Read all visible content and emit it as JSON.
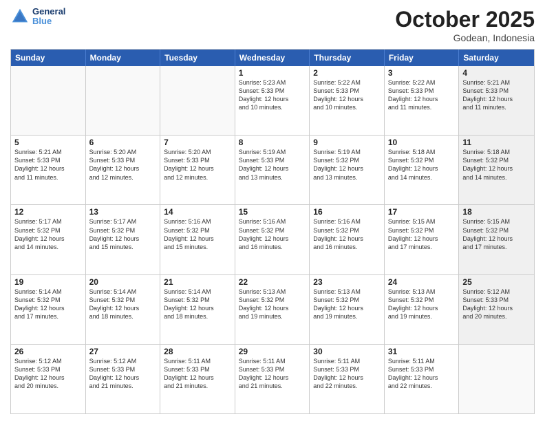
{
  "header": {
    "logo_line1": "General",
    "logo_line2": "Blue",
    "month_title": "October 2025",
    "location": "Godean, Indonesia"
  },
  "day_headers": [
    "Sunday",
    "Monday",
    "Tuesday",
    "Wednesday",
    "Thursday",
    "Friday",
    "Saturday"
  ],
  "weeks": [
    [
      {
        "num": "",
        "info": "",
        "empty": true
      },
      {
        "num": "",
        "info": "",
        "empty": true
      },
      {
        "num": "",
        "info": "",
        "empty": true
      },
      {
        "num": "1",
        "info": "Sunrise: 5:23 AM\nSunset: 5:33 PM\nDaylight: 12 hours\nand 10 minutes.",
        "empty": false
      },
      {
        "num": "2",
        "info": "Sunrise: 5:22 AM\nSunset: 5:33 PM\nDaylight: 12 hours\nand 10 minutes.",
        "empty": false
      },
      {
        "num": "3",
        "info": "Sunrise: 5:22 AM\nSunset: 5:33 PM\nDaylight: 12 hours\nand 11 minutes.",
        "empty": false
      },
      {
        "num": "4",
        "info": "Sunrise: 5:21 AM\nSunset: 5:33 PM\nDaylight: 12 hours\nand 11 minutes.",
        "empty": false,
        "shaded": true
      }
    ],
    [
      {
        "num": "5",
        "info": "Sunrise: 5:21 AM\nSunset: 5:33 PM\nDaylight: 12 hours\nand 11 minutes.",
        "empty": false
      },
      {
        "num": "6",
        "info": "Sunrise: 5:20 AM\nSunset: 5:33 PM\nDaylight: 12 hours\nand 12 minutes.",
        "empty": false
      },
      {
        "num": "7",
        "info": "Sunrise: 5:20 AM\nSunset: 5:33 PM\nDaylight: 12 hours\nand 12 minutes.",
        "empty": false
      },
      {
        "num": "8",
        "info": "Sunrise: 5:19 AM\nSunset: 5:33 PM\nDaylight: 12 hours\nand 13 minutes.",
        "empty": false
      },
      {
        "num": "9",
        "info": "Sunrise: 5:19 AM\nSunset: 5:32 PM\nDaylight: 12 hours\nand 13 minutes.",
        "empty": false
      },
      {
        "num": "10",
        "info": "Sunrise: 5:18 AM\nSunset: 5:32 PM\nDaylight: 12 hours\nand 14 minutes.",
        "empty": false
      },
      {
        "num": "11",
        "info": "Sunrise: 5:18 AM\nSunset: 5:32 PM\nDaylight: 12 hours\nand 14 minutes.",
        "empty": false,
        "shaded": true
      }
    ],
    [
      {
        "num": "12",
        "info": "Sunrise: 5:17 AM\nSunset: 5:32 PM\nDaylight: 12 hours\nand 14 minutes.",
        "empty": false
      },
      {
        "num": "13",
        "info": "Sunrise: 5:17 AM\nSunset: 5:32 PM\nDaylight: 12 hours\nand 15 minutes.",
        "empty": false
      },
      {
        "num": "14",
        "info": "Sunrise: 5:16 AM\nSunset: 5:32 PM\nDaylight: 12 hours\nand 15 minutes.",
        "empty": false
      },
      {
        "num": "15",
        "info": "Sunrise: 5:16 AM\nSunset: 5:32 PM\nDaylight: 12 hours\nand 16 minutes.",
        "empty": false
      },
      {
        "num": "16",
        "info": "Sunrise: 5:16 AM\nSunset: 5:32 PM\nDaylight: 12 hours\nand 16 minutes.",
        "empty": false
      },
      {
        "num": "17",
        "info": "Sunrise: 5:15 AM\nSunset: 5:32 PM\nDaylight: 12 hours\nand 17 minutes.",
        "empty": false
      },
      {
        "num": "18",
        "info": "Sunrise: 5:15 AM\nSunset: 5:32 PM\nDaylight: 12 hours\nand 17 minutes.",
        "empty": false,
        "shaded": true
      }
    ],
    [
      {
        "num": "19",
        "info": "Sunrise: 5:14 AM\nSunset: 5:32 PM\nDaylight: 12 hours\nand 17 minutes.",
        "empty": false
      },
      {
        "num": "20",
        "info": "Sunrise: 5:14 AM\nSunset: 5:32 PM\nDaylight: 12 hours\nand 18 minutes.",
        "empty": false
      },
      {
        "num": "21",
        "info": "Sunrise: 5:14 AM\nSunset: 5:32 PM\nDaylight: 12 hours\nand 18 minutes.",
        "empty": false
      },
      {
        "num": "22",
        "info": "Sunrise: 5:13 AM\nSunset: 5:32 PM\nDaylight: 12 hours\nand 19 minutes.",
        "empty": false
      },
      {
        "num": "23",
        "info": "Sunrise: 5:13 AM\nSunset: 5:32 PM\nDaylight: 12 hours\nand 19 minutes.",
        "empty": false
      },
      {
        "num": "24",
        "info": "Sunrise: 5:13 AM\nSunset: 5:32 PM\nDaylight: 12 hours\nand 19 minutes.",
        "empty": false
      },
      {
        "num": "25",
        "info": "Sunrise: 5:12 AM\nSunset: 5:33 PM\nDaylight: 12 hours\nand 20 minutes.",
        "empty": false,
        "shaded": true
      }
    ],
    [
      {
        "num": "26",
        "info": "Sunrise: 5:12 AM\nSunset: 5:33 PM\nDaylight: 12 hours\nand 20 minutes.",
        "empty": false
      },
      {
        "num": "27",
        "info": "Sunrise: 5:12 AM\nSunset: 5:33 PM\nDaylight: 12 hours\nand 21 minutes.",
        "empty": false
      },
      {
        "num": "28",
        "info": "Sunrise: 5:11 AM\nSunset: 5:33 PM\nDaylight: 12 hours\nand 21 minutes.",
        "empty": false
      },
      {
        "num": "29",
        "info": "Sunrise: 5:11 AM\nSunset: 5:33 PM\nDaylight: 12 hours\nand 21 minutes.",
        "empty": false
      },
      {
        "num": "30",
        "info": "Sunrise: 5:11 AM\nSunset: 5:33 PM\nDaylight: 12 hours\nand 22 minutes.",
        "empty": false
      },
      {
        "num": "31",
        "info": "Sunrise: 5:11 AM\nSunset: 5:33 PM\nDaylight: 12 hours\nand 22 minutes.",
        "empty": false
      },
      {
        "num": "",
        "info": "",
        "empty": true,
        "shaded": true
      }
    ]
  ]
}
